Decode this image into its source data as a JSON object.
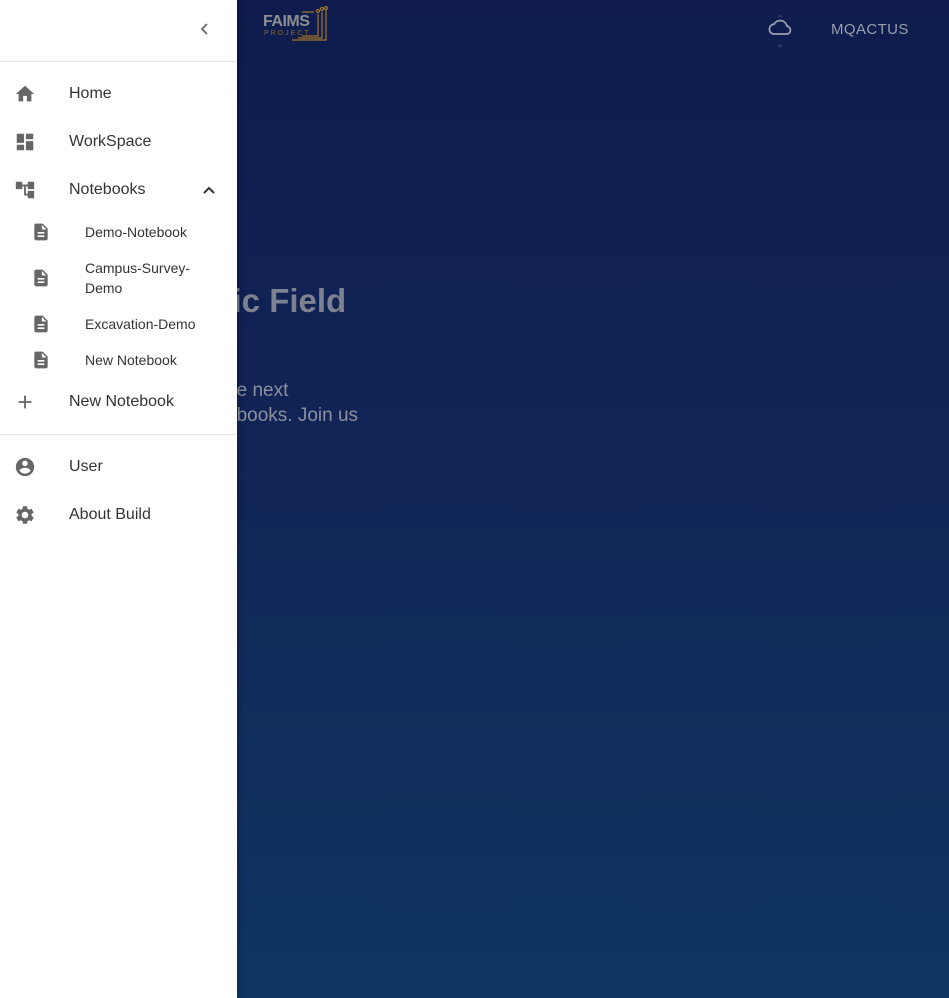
{
  "app": {
    "logo_text": "FAIMS",
    "logo_sub": "PROJECT",
    "username": "MQACTUS",
    "hero_title": "ctronic Field",
    "hero_sub_line1": "building the next",
    "hero_sub_line2": "Field Notebooks. Join us"
  },
  "drawer": {
    "items": [
      {
        "label": "Home",
        "icon": "home-icon"
      },
      {
        "label": "WorkSpace",
        "icon": "dashboard-icon"
      },
      {
        "label": "Notebooks",
        "icon": "account-tree-icon"
      }
    ],
    "notebooks": [
      {
        "label": "Demo-Notebook",
        "icon": "description-icon"
      },
      {
        "label": "Campus-Survey-Demo",
        "icon": "description-icon"
      },
      {
        "label": "Excavation-Demo",
        "icon": "description-icon"
      },
      {
        "label": "New Notebook",
        "icon": "description-icon"
      }
    ],
    "new_notebook": "New Notebook",
    "footer_items": [
      {
        "label": "User",
        "icon": "account-circle-icon"
      },
      {
        "label": "About Build",
        "icon": "settings-icon"
      }
    ]
  },
  "colors": {
    "icon": "#666666",
    "text": "#333333",
    "background_top": "#0f1c4d",
    "background_bottom": "#0f3663"
  }
}
